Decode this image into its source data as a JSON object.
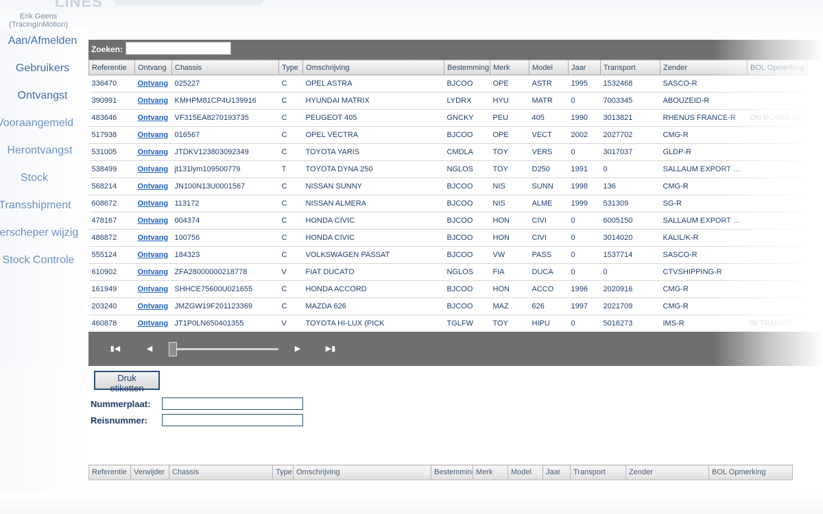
{
  "user": {
    "name": "Erik Geens",
    "org": "(TracingInMotion)"
  },
  "nav": [
    {
      "label": "Aan/Afmelden"
    },
    {
      "label": "Gebruikers"
    },
    {
      "label": "Ontvangst"
    },
    {
      "label": "Vooraangemeld"
    },
    {
      "label": "Herontvangst"
    },
    {
      "label": "Stock"
    },
    {
      "label": "Transshipment"
    },
    {
      "label": "Verscheper wijzig"
    },
    {
      "label": "Stock Controle"
    }
  ],
  "search": {
    "label": "Zoeken:",
    "value": ""
  },
  "grid": {
    "columns": [
      "Referentie",
      "Ontvang",
      "Chassis",
      "Type",
      "Omschrijving",
      "Bestemming",
      "Merk",
      "Model",
      "Jaar",
      "Transport",
      "Zender",
      "BOL Opmerking"
    ],
    "rows": [
      [
        "336470",
        "Ontvang",
        "025227",
        "C",
        "OPEL ASTRA",
        "BJCOO",
        "OPE",
        "ASTR",
        "1995",
        "1532468",
        "SASCO-R",
        ""
      ],
      [
        "390991",
        "Ontvang",
        "KMHPM81CP4U139916",
        "C",
        "HYUNDAI MATRIX",
        "LYDRX",
        "HYU",
        "MATR",
        "0",
        "7003345",
        "ABOUZEID-R",
        ""
      ],
      [
        "483646",
        "Ontvang",
        "VF315EA8270193735",
        "C",
        "PEUGEOT 405",
        "GNCKY",
        "PEU",
        "405",
        "1990",
        "3013821",
        "RHENUS FRANCE-R",
        "ON BOARD AV"
      ],
      [
        "517938",
        "Ontvang",
        "016567",
        "C",
        "OPEL VECTRA",
        "BJCOO",
        "OPE",
        "VECT",
        "2002",
        "2027702",
        "CMG-R",
        ""
      ],
      [
        "531005",
        "Ontvang",
        "JTDKV123803092349",
        "C",
        "TOYOTA YARIS",
        "CMDLA",
        "TOY",
        "VERS",
        "0",
        "3017037",
        "GLDP-R",
        ""
      ],
      [
        "538499",
        "Ontvang",
        "jt131lym109500779",
        "T",
        "TOYOTA DYNA 250",
        "NGLOS",
        "TOY",
        "D250",
        "1991",
        "0",
        "SALLAUM EXPORT C...",
        ""
      ],
      [
        "568214",
        "Ontvang",
        "JN100N13U0001567",
        "C",
        "NISSAN SUNNY",
        "BJCOO",
        "NIS",
        "SUNN",
        "1998",
        "136",
        "CMG-R",
        ""
      ],
      [
        "608672",
        "Ontvang",
        "113172",
        "C",
        "NISSAN ALMERA",
        "BJCOO",
        "NIS",
        "ALME",
        "1999",
        "531309",
        "SG-R",
        ""
      ],
      [
        "478167",
        "Ontvang",
        "004374",
        "C",
        "HONDA CIVIC",
        "BJCOO",
        "HON",
        "CIVI",
        "0",
        "6005150",
        "SALLAUM EXPORT C...",
        ""
      ],
      [
        "486872",
        "Ontvang",
        "100756",
        "C",
        "HONDA CIVIC",
        "BJCOO",
        "HON",
        "CIVI",
        "0",
        "3014020",
        "KALIL/K-R",
        ""
      ],
      [
        "555124",
        "Ontvang",
        "184323",
        "C",
        "VOLKSWAGEN PASSAT",
        "BJCOO",
        "VW",
        "PASS",
        "0",
        "1537714",
        "SASCO-R",
        ""
      ],
      [
        "610902",
        "Ontvang",
        "ZFA28000000218778",
        "V",
        "FIAT DUCATO",
        "NGLOS",
        "FIA",
        "DUCA",
        "0",
        "0",
        "CTVSHIPPING-R",
        ""
      ],
      [
        "161949",
        "Ontvang",
        "SHHCE75600U021655",
        "C",
        "HONDA ACCORD",
        "BJCOO",
        "HON",
        "ACCO",
        "1996",
        "2020916",
        "CMG-R",
        ""
      ],
      [
        "203240",
        "Ontvang",
        "JMZGW19F201123369",
        "C",
        "MAZDA 626",
        "BJCOO",
        "MAZ",
        "626",
        "1997",
        "2021709",
        "CMG-R",
        ""
      ],
      [
        "460878",
        "Ontvang",
        "JT1P0LN650401355",
        "V",
        "TOYOTA HI-LUX (PICK",
        "TGLFW",
        "TOY",
        "HIPU",
        "0",
        "5016273",
        "IMS-R",
        "IN TRANSIT"
      ]
    ]
  },
  "pager": {
    "first": "first-page",
    "prev": "previous-page",
    "next": "next-page",
    "last": "last-page",
    "position": 0.0
  },
  "form": {
    "print_label": "Druk etiketten",
    "plate_label": "Nummerplaat:",
    "plate_value": "",
    "trip_label": "Reisnummer:",
    "trip_value": ""
  },
  "grid2": {
    "columns": [
      "Referentie",
      "Verwijder",
      "Chassis",
      "Type",
      "Omschrijving",
      "Bestemming",
      "Merk",
      "Model",
      "Jaar",
      "Transport",
      "Zender",
      "BOL Opmerking"
    ]
  }
}
